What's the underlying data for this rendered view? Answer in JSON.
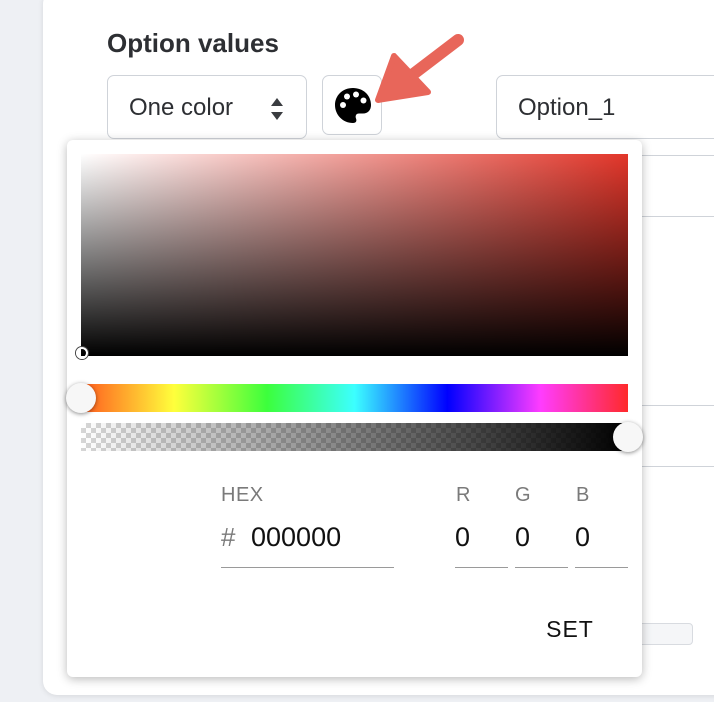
{
  "section": {
    "title": "Option values"
  },
  "select": {
    "value": "One color"
  },
  "palette_button": {
    "icon": "palette-icon"
  },
  "option_input": {
    "value": "Option_1"
  },
  "annotation": {
    "icon": "arrow-icon",
    "color": "#e8665a"
  },
  "color_picker": {
    "hue_color": "#e2362a",
    "hex": {
      "label": "HEX",
      "prefix": "#",
      "value": "000000"
    },
    "rgb": [
      {
        "label": "R",
        "value": "0"
      },
      {
        "label": "G",
        "value": "0"
      },
      {
        "label": "B",
        "value": "0"
      }
    ],
    "hue_level": 0,
    "alpha_level": 1,
    "set_label": "SET"
  }
}
